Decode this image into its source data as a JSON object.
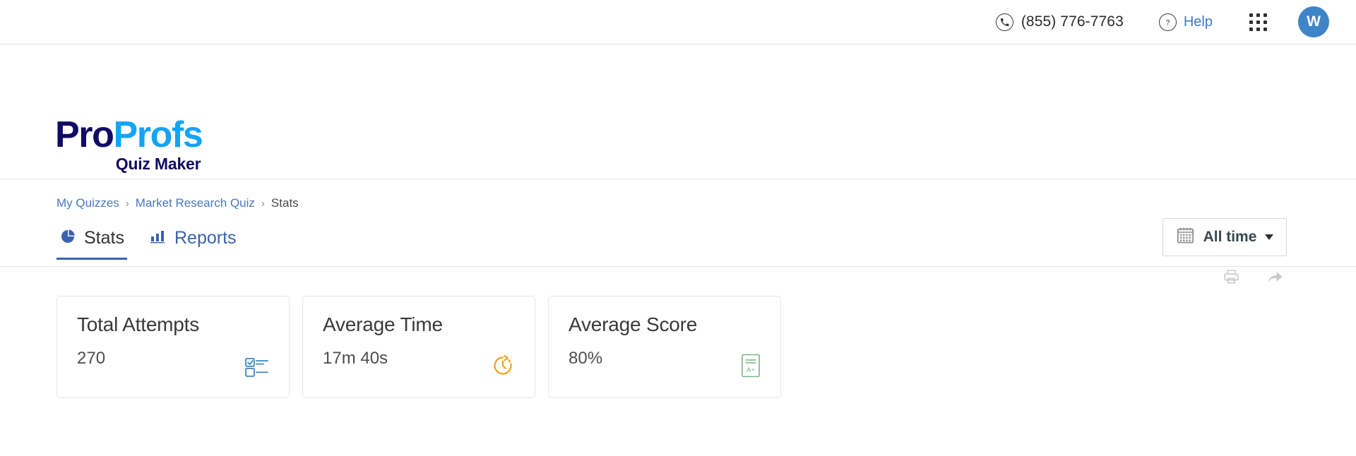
{
  "topbar": {
    "phone_icon": "phone-in-circle-icon",
    "phone_number": "(855) 776-7763",
    "help_icon": "question-mark-circle-icon",
    "help_label": "Help",
    "apps_icon": "grid-apps-icon",
    "avatar_initial": "W",
    "avatar_color": "#3d85c6"
  },
  "logo": {
    "part1": "Pro",
    "part2": "Profs",
    "subtitle": "Quiz Maker",
    "color_dark": "#120b63",
    "color_light": "#13a4f7"
  },
  "breadcrumb": {
    "items": [
      {
        "label": "My Quizzes",
        "is_link": true
      },
      {
        "label": "Market Research Quiz",
        "is_link": true
      },
      {
        "label": "Stats",
        "is_link": false
      }
    ],
    "separator": "›"
  },
  "tabs": [
    {
      "label": "Stats",
      "icon": "pie-chart-icon",
      "active": true
    },
    {
      "label": "Reports",
      "icon": "bar-chart-icon",
      "active": false
    }
  ],
  "date_filter": {
    "icon": "calendar-icon",
    "label": "All time",
    "caret": "chevron-down-icon"
  },
  "action_icons": [
    {
      "name": "print-icon"
    },
    {
      "name": "share-icon"
    }
  ],
  "cards": [
    {
      "title": "Total Attempts",
      "value": "270",
      "icon": "checklist-icon",
      "icon_color": "#3d85c6"
    },
    {
      "title": "Average Time",
      "value": "17m 40s",
      "icon": "stopwatch-icon",
      "icon_color": "#f79e1b"
    },
    {
      "title": "Average Score",
      "value": "80%",
      "icon": "grade-sheet-icon",
      "icon_label": "A+",
      "icon_color": "#79b48a"
    }
  ],
  "theme": {
    "link_blue": "#4878bd",
    "tab_blue": "#3a62ae",
    "border_gray": "#e2e2e2"
  }
}
